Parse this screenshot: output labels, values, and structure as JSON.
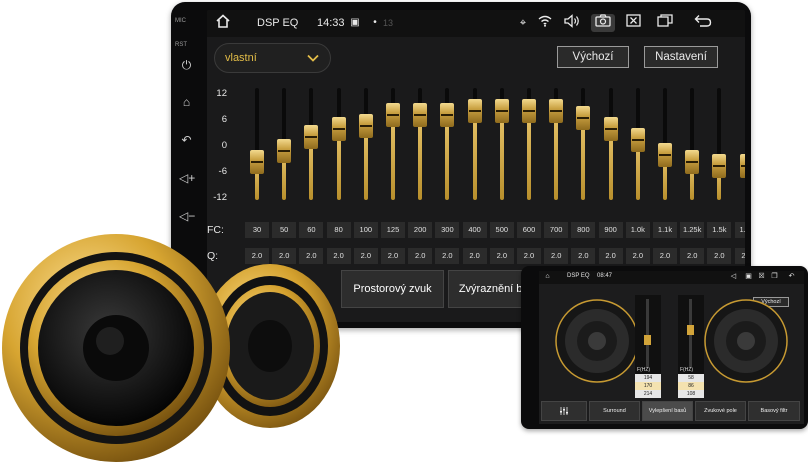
{
  "side": {
    "mic_label": "MIC",
    "rst_label": "RST"
  },
  "status": {
    "app_title": "DSP EQ",
    "time": "14:33",
    "notif_count": "13"
  },
  "preset": {
    "selected": "vlastní"
  },
  "buttons": {
    "default_label": "Výchozí",
    "settings_label": "Nastavení"
  },
  "eq": {
    "db_scale": [
      "12",
      "6",
      "0",
      "-6",
      "-12"
    ],
    "gain_range": [
      -12,
      12
    ],
    "gains": [
      -5,
      -2,
      2,
      4,
      5,
      8,
      8,
      8,
      9,
      9,
      9,
      9,
      7,
      4,
      1,
      -3,
      -5,
      -6,
      -6
    ],
    "fc_label": "FC:",
    "q_label": "Q:",
    "frequencies": [
      "30",
      "50",
      "60",
      "80",
      "100",
      "125",
      "200",
      "300",
      "400",
      "500",
      "600",
      "700",
      "800",
      "900",
      "1.0k",
      "1.1k",
      "1.25k",
      "1.5k",
      "1.8k"
    ],
    "q_values": [
      "2.0",
      "2.0",
      "2.0",
      "2.0",
      "2.0",
      "2.0",
      "2.0",
      "2.0",
      "2.0",
      "2.0",
      "2.0",
      "2.0",
      "2.0",
      "2.0",
      "2.0",
      "2.0",
      "2.0",
      "2.0",
      "2.0"
    ]
  },
  "modes": {
    "surround": "Prostorový zvuk",
    "bass_boost": "Zvýraznění basů"
  },
  "small_screen": {
    "title": "DSP EQ",
    "time": "08:47",
    "default_label": "Výchozí",
    "left_panel": {
      "label": "F(HZ)",
      "values": [
        "194",
        "170",
        "214"
      ]
    },
    "right_panel": {
      "label": "F(HZ)",
      "values": [
        "58",
        "86",
        "108"
      ]
    },
    "tabs": [
      "Surround",
      "Vylepšení basů",
      "Zvukové pole",
      "Basový filtr"
    ],
    "active_tab": 1
  },
  "colors": {
    "accent_gold": "#e3bd48",
    "screen_bg": "#1a1a1b",
    "frame": "#0b0b0c"
  }
}
